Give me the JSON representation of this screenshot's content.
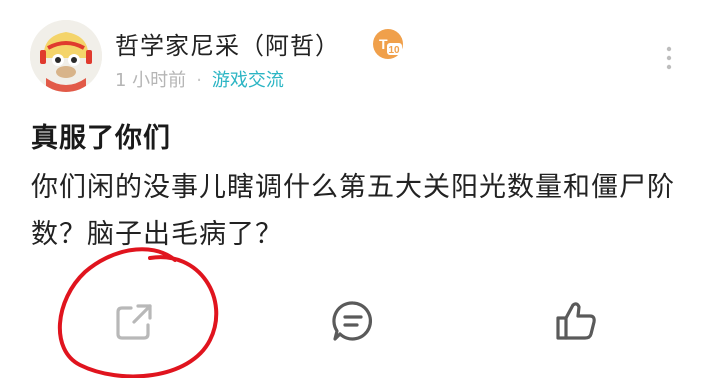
{
  "post": {
    "author": "哲学家尼采（阿哲）",
    "level_badge": "T10",
    "time": "1 小时前",
    "separator": "·",
    "category": "游戏交流",
    "title": "真服了你们",
    "body": "你们闲的没事儿瞎调什么第五大关阳光数量和僵尸阶数？脑子出毛病了？"
  },
  "actions": {
    "share_icon": "share-icon",
    "comment_icon": "comment-icon",
    "like_icon": "thumbs-up-icon"
  },
  "colors": {
    "category": "#2bb5c4",
    "badge": "#f0a04b",
    "annotation": "#e0141e",
    "icon": "#5a5a5a"
  }
}
